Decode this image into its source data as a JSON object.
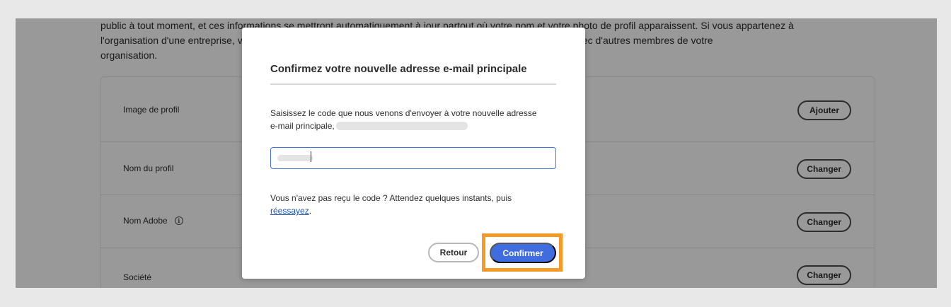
{
  "page": {
    "intro_line_1": "public à tout moment, et ces informations se mettront automatiquement à jour partout où votre nom et votre photo de profil apparaissent. Si vous appartenez à",
    "intro_line_2": "l'organisation d'une entreprise, vous pourriez aussi avoir besoin de ces informations lors des collaborations avec d'autres membres de votre",
    "intro_line_3": "organisation."
  },
  "profile": {
    "rows": [
      {
        "label": "Image de profil",
        "button": "Ajouter"
      },
      {
        "label": "Nom du profil",
        "button": "Changer"
      },
      {
        "label": "Nom Adobe",
        "button": "Changer"
      },
      {
        "label": "Société",
        "button": "Changer"
      }
    ]
  },
  "dialog": {
    "title": "Confirmez votre nouvelle adresse e-mail principale",
    "body_line_1": "Saisissez le code que nous venons d'envoyer à votre nouvelle adresse",
    "body_line_2": "e-mail principale,",
    "help_text": "Vous n'avez pas reçu le code ? Attendez quelques instants, puis",
    "retry_link": "réessayez",
    "retry_suffix": ".",
    "back_label": "Retour",
    "confirm_label": "Confirmer"
  },
  "colors": {
    "primary": "#3f6de0",
    "highlight": "#f59a26",
    "link": "#1a55b9"
  },
  "icons": {
    "info": "info-circle-icon"
  }
}
